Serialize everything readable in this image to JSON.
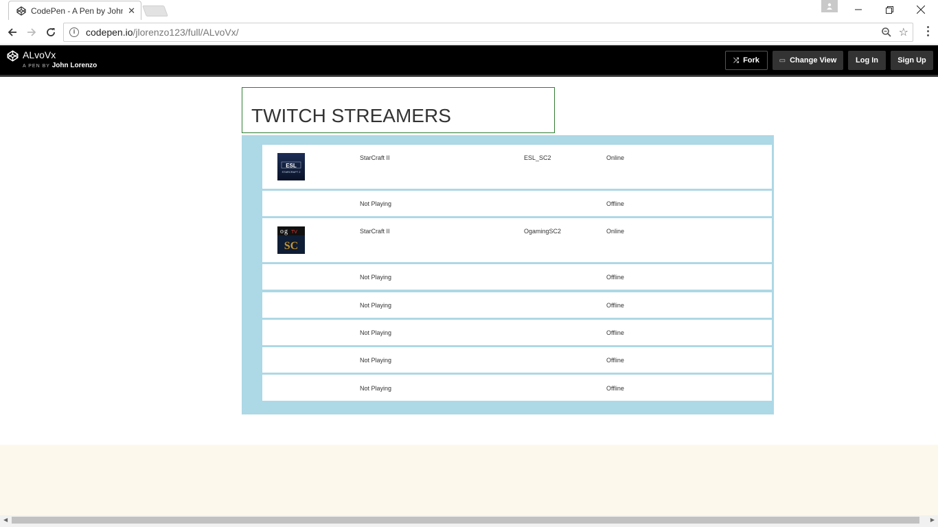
{
  "browser": {
    "tab_title": "CodePen - A Pen by John",
    "url_domain": "codepen.io",
    "url_path": "/jlorenzo123/full/ALvoVx/"
  },
  "codepen": {
    "pen_title": "ALvoVx",
    "by_prefix": "A PEN BY",
    "author": "John Lorenzo",
    "buttons": {
      "fork": "Fork",
      "change_view": "Change View",
      "log_in": "Log In",
      "sign_up": "Sign Up"
    }
  },
  "page": {
    "heading": "TWITCH STREAMERS",
    "streamers": [
      {
        "game": "StarCraft II",
        "name": "ESL_SC2",
        "status": "Online",
        "logo": "esl-starcraft-logo"
      },
      {
        "game": "Not Playing",
        "name": "",
        "status": "Offline"
      },
      {
        "game": "StarCraft II",
        "name": "OgamingSC2",
        "status": "Online",
        "logo": "ogtv-starcraft-logo"
      },
      {
        "game": "Not Playing",
        "name": "",
        "status": "Offline"
      },
      {
        "game": "Not Playing",
        "name": "",
        "status": "Offline"
      },
      {
        "game": "Not Playing",
        "name": "",
        "status": "Offline"
      },
      {
        "game": "Not Playing",
        "name": "",
        "status": "Offline"
      },
      {
        "game": "Not Playing",
        "name": "",
        "status": "Offline"
      }
    ]
  },
  "colors": {
    "panel_bg": "#add8e6",
    "heading_border": "#2e7d32",
    "header_bg": "#000000",
    "footer_bg": "#fdf8ec"
  }
}
